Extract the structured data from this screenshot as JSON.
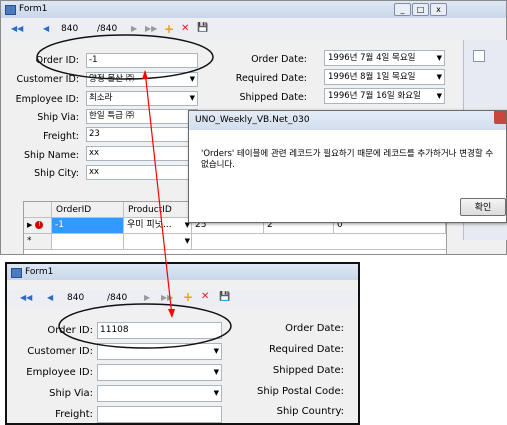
{
  "top_form": {
    "title": "Form1",
    "nav": {
      "first": "◀◀",
      "prev": "◀",
      "position": "840",
      "count": "/840",
      "next": "▶",
      "last": "▶▶",
      "add": "+",
      "delete": "✕",
      "save": "💾"
    },
    "labels": {
      "order_id": "Order ID:",
      "customer_id": "Customer ID:",
      "employee_id": "Employee ID:",
      "ship_via": "Ship Via:",
      "freight": "Freight:",
      "ship_name": "Ship Name:",
      "ship_city": "Ship City:",
      "order_date": "Order Date:",
      "required_date": "Required Date:",
      "shipped_date": "Shipped Date:"
    },
    "values": {
      "order_id": "-1",
      "customer_id": "양정 물산 ㈜",
      "employee_id": "최소라",
      "ship_via": "한일 특급 ㈜",
      "freight": "23",
      "ship_name": "xx",
      "ship_city": "xx",
      "order_date": "1996년  7월  4일 목요일",
      "required_date": "1996년  8월  1일 목요일",
      "shipped_date": "1996년  7월 16일 화요일"
    },
    "grid": {
      "columns": [
        "OrderID",
        "ProductID"
      ],
      "rows": [
        {
          "order_id": "-1",
          "product": "우미 피넛...",
          "c3": "25",
          "c4": "2",
          "c5": "0"
        }
      ],
      "new_row_marker": "*"
    }
  },
  "dialog": {
    "title": "UNO_Weekly_VB.Net_030",
    "message": "'Orders' 테이블에 관련 레코드가 필요하기 때문에 레코드를 추가하거나 변경할 수 없습니다.",
    "ok_label": "확인"
  },
  "bottom_form": {
    "title": "Form1",
    "nav": {
      "first": "◀◀",
      "prev": "◀",
      "position": "840",
      "count": "/840",
      "next": "▶",
      "last": "▶▶",
      "add": "+",
      "delete": "✕",
      "save": "💾"
    },
    "labels": {
      "order_id": "Order ID:",
      "customer_id": "Customer ID:",
      "employee_id": "Employee ID:",
      "ship_via": "Ship Via:",
      "freight": "Freight:",
      "order_date": "Order Date:",
      "required_date": "Required Date:",
      "shipped_date": "Shipped Date:",
      "ship_postal_code": "Ship Postal Code:",
      "ship_country": "Ship Country:"
    },
    "values": {
      "order_id": "11108"
    }
  },
  "colors": {
    "accent": "#ff0000",
    "selection": "#3399ff"
  }
}
